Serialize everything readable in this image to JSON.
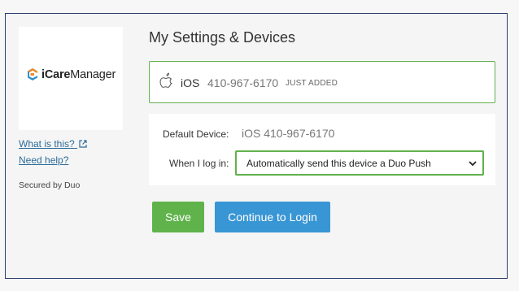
{
  "brand": {
    "name_bold": "iCare",
    "name_regular": "Manager",
    "colors": {
      "orange": "#f08a24",
      "teal": "#2f8fc6"
    }
  },
  "sidebar": {
    "what_is_this": "What is this?",
    "need_help": "Need help?",
    "secured_by": "Secured by Duo"
  },
  "main": {
    "title": "My Settings & Devices",
    "device": {
      "icon": "apple-icon",
      "os": "iOS",
      "phone": "410-967-6170",
      "badge": "JUST ADDED"
    },
    "settings": {
      "default_device_label": "Default Device:",
      "default_device_value": "iOS 410-967-6170",
      "login_label": "When I log in:",
      "login_selected": "Automatically send this device a Duo Push"
    },
    "buttons": {
      "save": "Save",
      "continue": "Continue to Login"
    }
  },
  "colors": {
    "accent_green": "#5fb34a",
    "accent_blue": "#3996d4",
    "frame_border": "#2b3f6b",
    "link": "#2c6c9a"
  }
}
